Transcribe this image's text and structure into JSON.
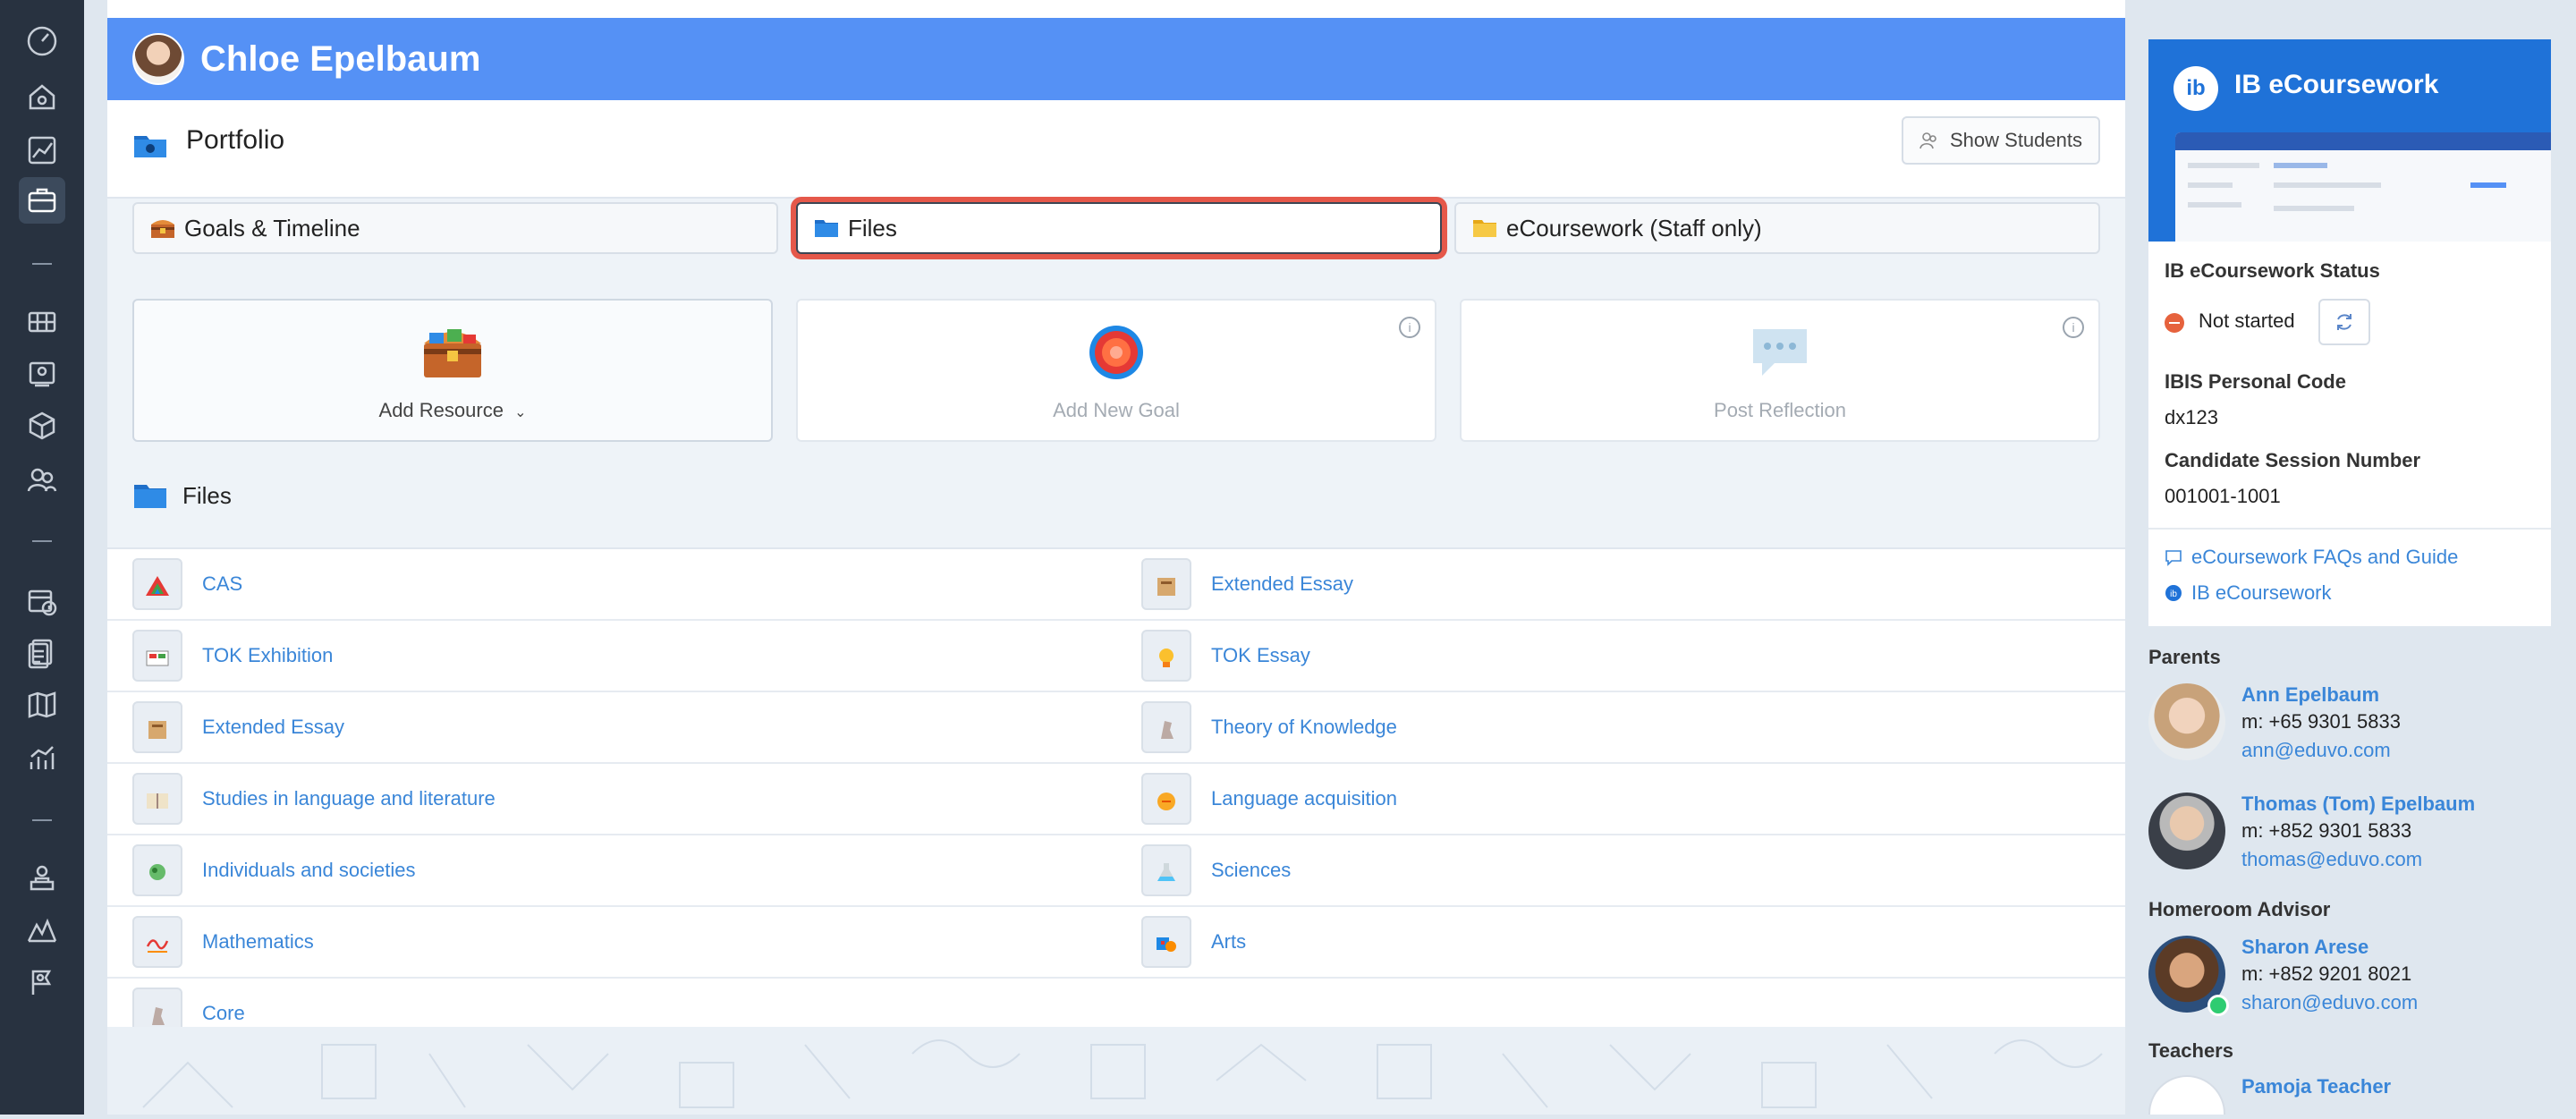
{
  "student": {
    "name": "Chloe Epelbaum"
  },
  "portfolio": {
    "title": "Portfolio",
    "show_students_label": "Show Students"
  },
  "tabs": [
    {
      "label": "Goals & Timeline",
      "icon": "treasure-chest-icon",
      "selected": false
    },
    {
      "label": "Files",
      "icon": "folder-icon",
      "selected": true
    },
    {
      "label": "eCoursework (Staff only)",
      "icon": "folder-yellow-icon",
      "selected": false
    }
  ],
  "actions": [
    {
      "label": "Add Resource",
      "icon": "treasure-chest-icon",
      "dropdown": true
    },
    {
      "label": "Add New Goal",
      "icon": "target-icon",
      "dropdown": false
    },
    {
      "label": "Post Reflection",
      "icon": "speech-bubble-icon",
      "dropdown": false
    }
  ],
  "files": {
    "heading": "Files",
    "rows": [
      {
        "left": "CAS",
        "right": "Extended Essay"
      },
      {
        "left": "TOK Exhibition",
        "right": "TOK Essay"
      },
      {
        "left": "Extended Essay",
        "right": "Theory of Knowledge"
      },
      {
        "left": "Studies in language and literature",
        "right": "Language acquisition"
      },
      {
        "left": "Individuals and societies",
        "right": "Sciences"
      },
      {
        "left": "Mathematics",
        "right": "Arts"
      },
      {
        "left": "Core",
        "right": ""
      }
    ]
  },
  "ib": {
    "title": "IB eCoursework",
    "status_label": "IB eCoursework Status",
    "status_value": "Not started",
    "code_label": "IBIS Personal Code",
    "code_value": "dx123",
    "session_label": "Candidate Session Number",
    "session_value": "001001-1001",
    "faq_link": "eCoursework FAQs and Guide",
    "ib_link": "IB eCoursework"
  },
  "parents": {
    "title": "Parents",
    "people": [
      {
        "name": "Ann Epelbaum",
        "phone": "m: +65 9301 5833",
        "email": "ann@eduvo.com"
      },
      {
        "name": "Thomas (Tom) Epelbaum",
        "phone": "m: +852 9301 5833",
        "email": "thomas@eduvo.com"
      }
    ]
  },
  "homeroom": {
    "title": "Homeroom Advisor",
    "person": {
      "name": "Sharon Arese",
      "phone": "m: +852 9201 8021",
      "email": "sharon@eduvo.com"
    }
  },
  "teachers": {
    "title": "Teachers",
    "person": {
      "name": "Pamoja Teacher"
    }
  },
  "colors": {
    "header": "#5591f5",
    "rail": "#283240",
    "link": "#3a86d8",
    "highlight": "#e5584a"
  }
}
